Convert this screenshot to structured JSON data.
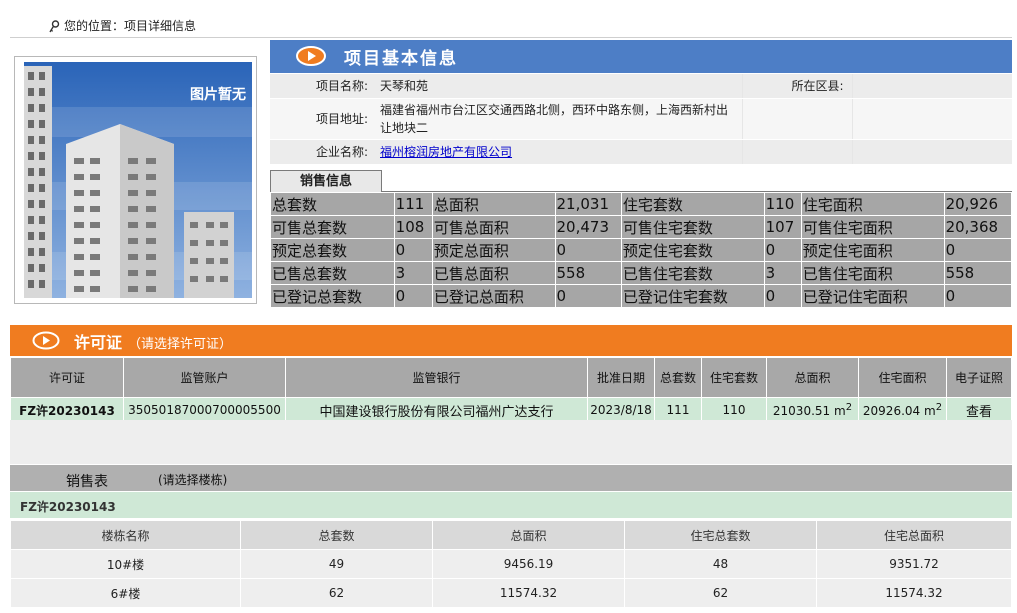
{
  "breadcrumb": {
    "label": "您的位置：",
    "current": "项目详细信息"
  },
  "photo": {
    "placeholder_text": "图片暂无"
  },
  "basic": {
    "title": "项目基本信息",
    "name_label": "项目名称:",
    "name_value": "天琴和苑",
    "district_label": "所在区县:",
    "district_value": "",
    "address_label": "项目地址:",
    "address_value": "福建省福州市台江区交通西路北侧，西环中路东侧，上海西新村出让地块二",
    "company_label": "企业名称:",
    "company_value": "福州榕润房地产有限公司"
  },
  "sales": {
    "tab_label": "销售信息",
    "rows": [
      [
        "总套数",
        "111",
        "总面积",
        "21,031",
        "住宅套数",
        "110",
        "住宅面积",
        "20,926"
      ],
      [
        "可售总套数",
        "108",
        "可售总面积",
        "20,473",
        "可售住宅套数",
        "107",
        "可售住宅面积",
        "20,368"
      ],
      [
        "预定总套数",
        "0",
        "预定总面积",
        "0",
        "预定住宅套数",
        "0",
        "预定住宅面积",
        "0"
      ],
      [
        "已售总套数",
        "3",
        "已售总面积",
        "558",
        "已售住宅套数",
        "3",
        "已售住宅面积",
        "558"
      ],
      [
        "已登记总套数",
        "0",
        "已登记总面积",
        "0",
        "已登记住宅套数",
        "0",
        "已登记住宅面积",
        "0"
      ]
    ]
  },
  "permit": {
    "title": "许可证",
    "subtitle": "（请选择许可证）",
    "columns": [
      "许可证",
      "监管账户",
      "监管银行",
      "批准日期",
      "总套数",
      "住宅套数",
      "总面积",
      "住宅面积",
      "电子证照"
    ],
    "row": {
      "no": "FZ许20230143",
      "account": "35050187000700005500",
      "bank": "中国建设银行股份有限公司福州广达支行",
      "date": "2023/8/18",
      "total_units": "111",
      "res_units": "110",
      "total_area": "21030.51",
      "res_area": "20926.04",
      "area_unit": "m",
      "area_sup": "2",
      "view": "查看"
    }
  },
  "sales_table": {
    "title": "销售表",
    "hint": "(请选择楼栋)",
    "permit_no": "FZ许20230143",
    "columns": [
      "楼栋名称",
      "总套数",
      "总面积",
      "住宅总套数",
      "住宅总面积"
    ],
    "rows": [
      [
        "10#楼",
        "49",
        "9456.19",
        "48",
        "9351.72"
      ],
      [
        "6#楼",
        "62",
        "11574.32",
        "62",
        "11574.32"
      ]
    ]
  },
  "colors": {
    "blue_header": "#4d7ec6",
    "orange_header": "#f07c20",
    "grid_gray": "#a6a6a6",
    "permit_green": "#cfe8d6"
  }
}
